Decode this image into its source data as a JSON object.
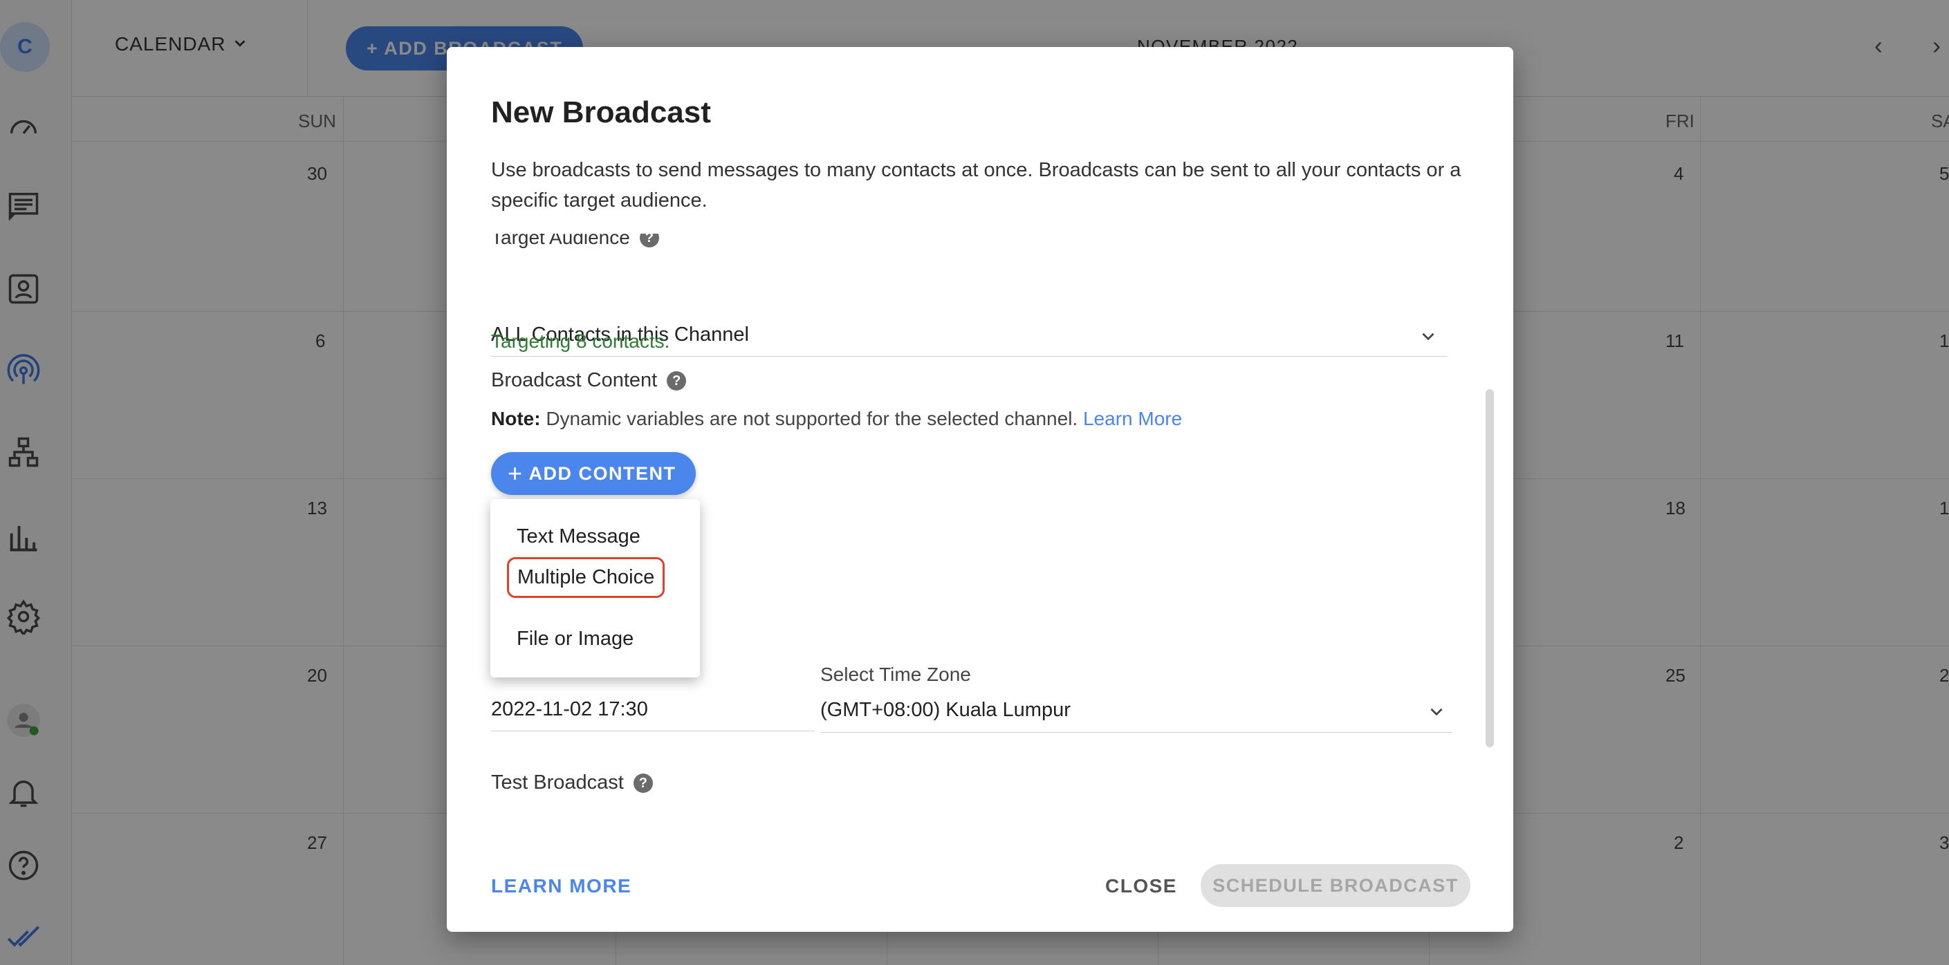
{
  "sidebar": {
    "avatar_initial": "C",
    "icons": [
      "dashboard-icon",
      "messages-icon",
      "contacts-icon",
      "broadcast-icon",
      "workflow-icon",
      "reports-icon",
      "settings-icon",
      "user-status-icon",
      "notifications-icon",
      "help-icon",
      "checkmarks-icon"
    ]
  },
  "topbar": {
    "calendar_label": "CALENDAR",
    "add_broadcast_label": "+ ADD BROADCAST",
    "month": "NOVEMBER 2022"
  },
  "calendar": {
    "weekdays": [
      "SUN",
      "FRI",
      "SA"
    ],
    "days": [
      "30",
      "4",
      "5",
      "6",
      "11",
      "1",
      "13",
      "18",
      "1",
      "20",
      "25",
      "2",
      "27",
      "2",
      "3"
    ]
  },
  "dialog": {
    "title": "New Broadcast",
    "description": "Use broadcasts to send messages to many contacts at once. Broadcasts can be sent to all your contacts or a specific target audience.",
    "target_audience_label": "Target Audience",
    "target_audience_value": "ALL Contacts in this Channel",
    "targeting_text": "Targeting 8 contacts.",
    "broadcast_content_label": "Broadcast Content",
    "note_bold": "Note:",
    "note_text": " Dynamic variables are not supported for the selected channel. ",
    "note_link": "Learn More",
    "add_content_label": "ADD CONTENT",
    "schedule_value": "2022-11-02 17:30",
    "timezone_label": "Select Time Zone",
    "timezone_value": "(GMT+08:00) Kuala Lumpur",
    "test_broadcast_label": "Test Broadcast",
    "footer": {
      "learn_more": "LEARN MORE",
      "close": "CLOSE",
      "schedule": "SCHEDULE BROADCAST"
    }
  },
  "menu": {
    "items": [
      "Text Message",
      "Multiple Choice",
      "File or Image"
    ],
    "highlighted": "Multiple Choice"
  },
  "colors": {
    "accent": "#4a86ec",
    "success": "#2e7d32",
    "highlight_border": "#e0412b"
  }
}
